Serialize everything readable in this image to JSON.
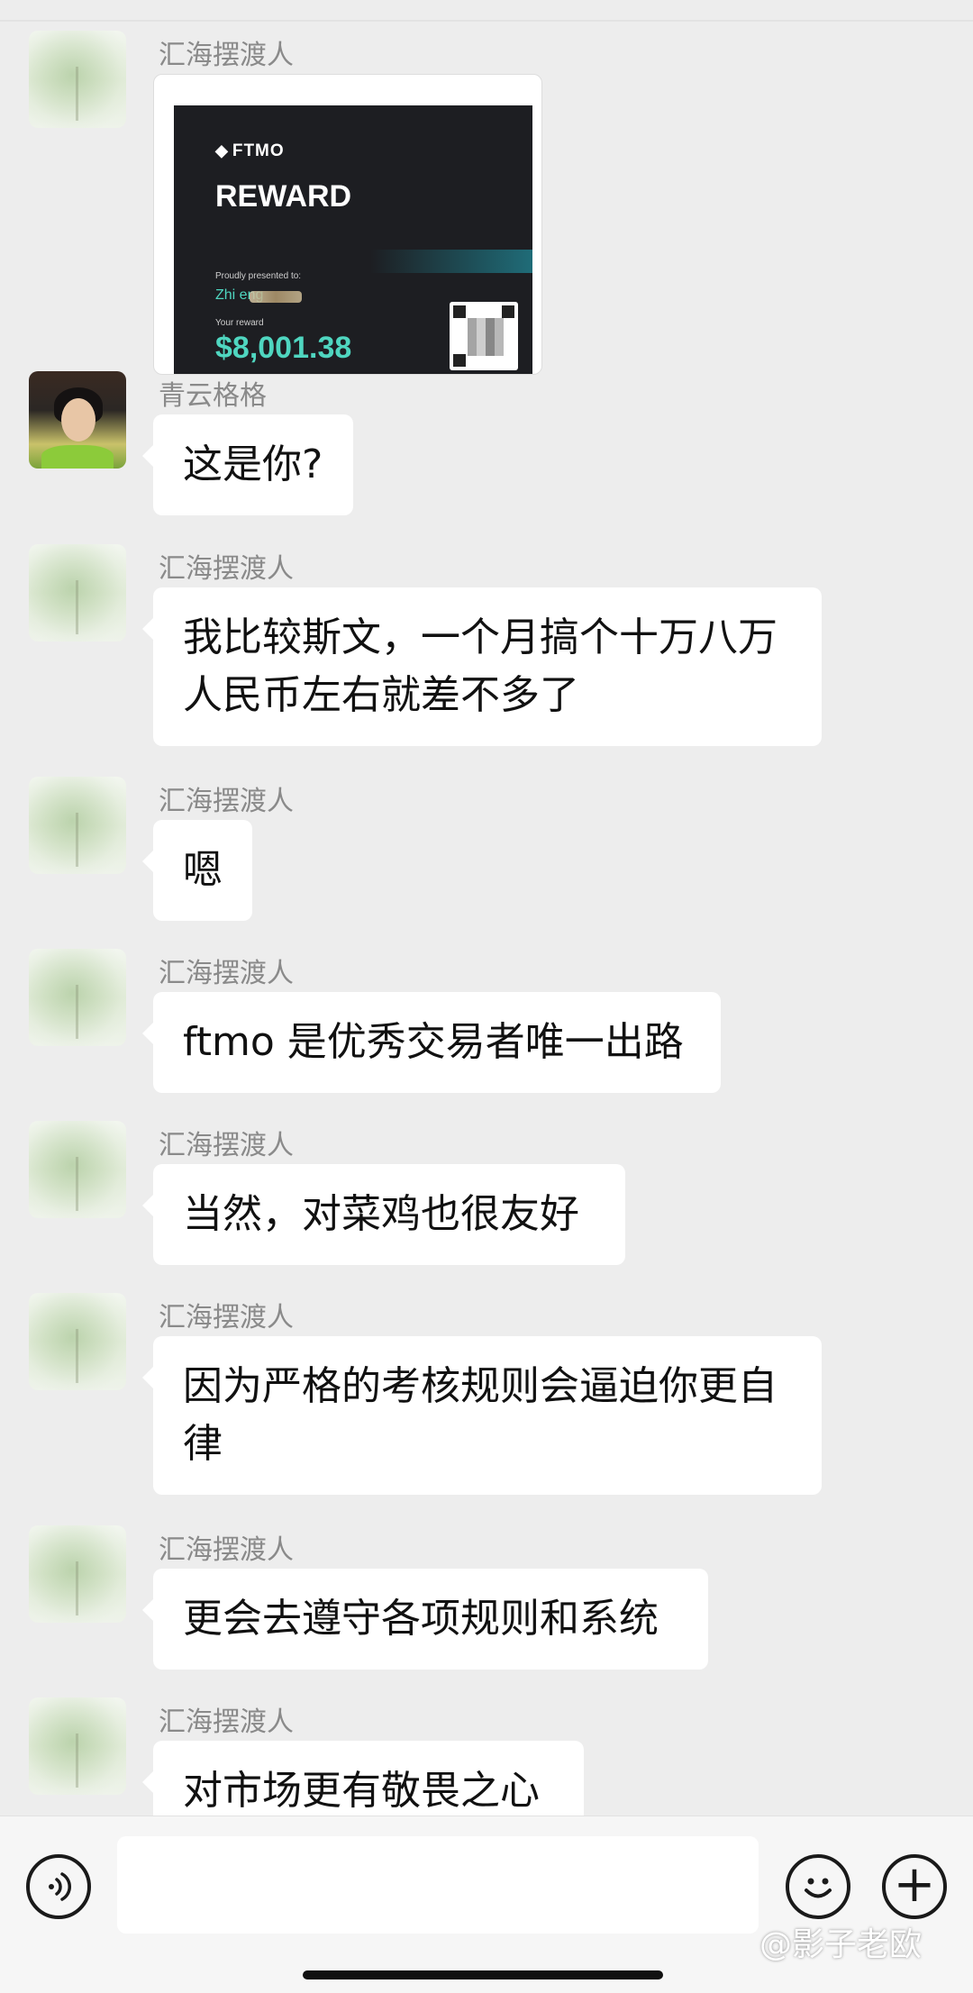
{
  "messages": [
    {
      "sender": "汇海摆渡人",
      "type": "image"
    },
    {
      "sender": "青云格格",
      "text": "这是你?"
    },
    {
      "sender": "汇海摆渡人",
      "text": "我比较斯文，一个月搞个十万八万人民币左右就差不多了"
    },
    {
      "sender": "汇海摆渡人",
      "text": "嗯"
    },
    {
      "sender": "汇海摆渡人",
      "text": "ftmo 是优秀交易者唯一出路"
    },
    {
      "sender": "汇海摆渡人",
      "text": "当然，对菜鸡也很友好"
    },
    {
      "sender": "汇海摆渡人",
      "text": "因为严格的考核规则会逼迫你更自律"
    },
    {
      "sender": "汇海摆渡人",
      "text": "更会去遵守各项规则和系统"
    },
    {
      "sender": "汇海摆渡人",
      "text": "对市场更有敬畏之心"
    }
  ],
  "reward_card": {
    "brand": "FTMO",
    "title": "REWARD",
    "presented_label": "Proudly presented to:",
    "recipient": "Zhi              eng",
    "reward_label": "Your reward",
    "amount": "$8,001.38",
    "accent_color": "#4fd6c0"
  },
  "input_bar": {
    "voice_icon": "voice-icon",
    "emoji_icon": "emoji-icon",
    "plus_icon": "plus-icon",
    "input_value": ""
  },
  "watermark": "@影子老欧"
}
